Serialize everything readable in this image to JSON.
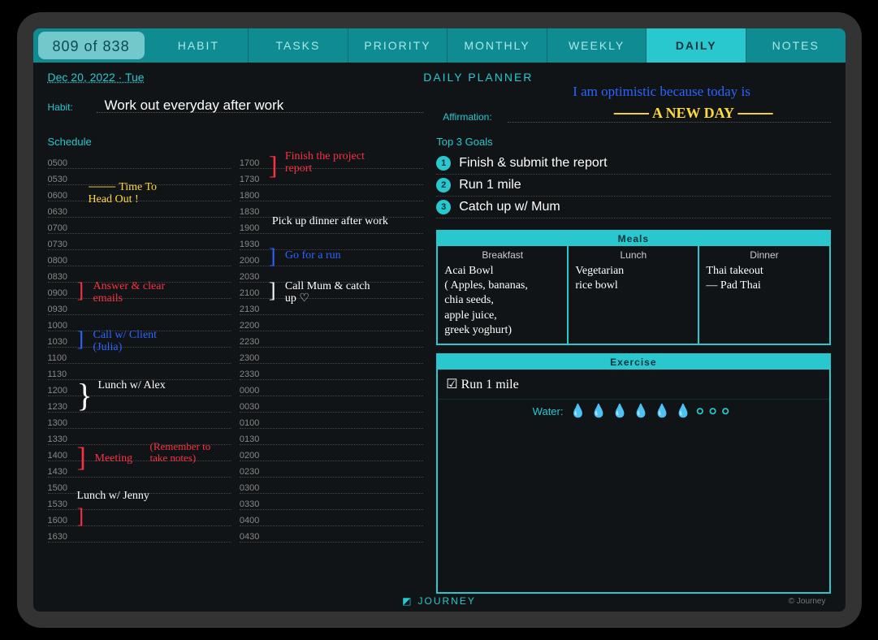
{
  "pageCounter": "809 of 838",
  "tabs": [
    {
      "label": "HABIT",
      "active": false
    },
    {
      "label": "TASKS",
      "active": false
    },
    {
      "label": "PRIORITY",
      "active": false
    },
    {
      "label": "MONTHLY",
      "active": false
    },
    {
      "label": "WEEKLY",
      "active": false
    },
    {
      "label": "DAILY",
      "active": true
    },
    {
      "label": "NOTES",
      "active": false
    }
  ],
  "date": "Dec 20, 2022 · Tue",
  "pageTitle": "DAILY PLANNER",
  "habitLabel": "Habit:",
  "habitText": "Work out everyday after work",
  "affirmLabel": "Affirmation:",
  "affirmation": {
    "line1": "I am optimistic because today is",
    "line2": "A NEW DAY",
    "left_decor": "⸻",
    "right_decor": "⸻"
  },
  "scheduleLabel": "Schedule",
  "scheduleLeftTimes": [
    "0500",
    "0530",
    "0600",
    "0630",
    "0700",
    "0730",
    "0800",
    "0830",
    "0900",
    "0930",
    "1000",
    "1030",
    "1100",
    "1130",
    "1200",
    "1230",
    "1300",
    "1330",
    "1400",
    "1430",
    "1500",
    "1530",
    "1600",
    "1630"
  ],
  "scheduleRightTimes": [
    "1700",
    "1730",
    "1800",
    "1830",
    "1900",
    "1930",
    "2000",
    "2030",
    "2100",
    "2130",
    "2200",
    "2230",
    "2300",
    "2330",
    "0000",
    "0030",
    "0100",
    "0130",
    "0200",
    "0230",
    "0300",
    "0330",
    "0400",
    "0430"
  ],
  "scheduleEntries": {
    "timeToHeadOut": "Time To\nHead Out !",
    "answerEmails": "Answer & clear\nemails",
    "callClient": "Call w/ Client\n(Julia)",
    "lunchAlex": "Lunch w/ Alex",
    "meeting": "Meeting",
    "meetingNote": "(Remember to\ntake notes)",
    "lunchJenny": "Lunch w/ Jenny",
    "finishProject": "Finish the project\nreport",
    "pickupDinner": "Pick up dinner after work",
    "goForRun": "Go for a run",
    "callMum": "Call Mum & catch\nup ♡"
  },
  "goalsLabel": "Top 3 Goals",
  "goals": [
    "Finish & submit the report",
    "Run 1 mile",
    "Catch up w/ Mum"
  ],
  "mealsHeader": "Meals",
  "meals": {
    "breakfast": {
      "title": "Breakfast",
      "text": "Acai Bowl\n( Apples, bananas,\nchia seeds,\napple juice,\ngreek yoghurt)"
    },
    "lunch": {
      "title": "Lunch",
      "text": "Vegetarian\nrice bowl"
    },
    "dinner": {
      "title": "Dinner",
      "text": "Thai takeout\n— Pad Thai"
    }
  },
  "exerciseHeader": "Exercise",
  "exerciseText": "☑ Run 1 mile",
  "waterLabel": "Water:",
  "waterDrops": [
    true,
    true,
    true,
    true,
    true,
    true,
    false,
    false,
    false
  ],
  "footerBrand": "JOURNEY",
  "footerBrandIcon": "◩",
  "copyright": "© Journey"
}
